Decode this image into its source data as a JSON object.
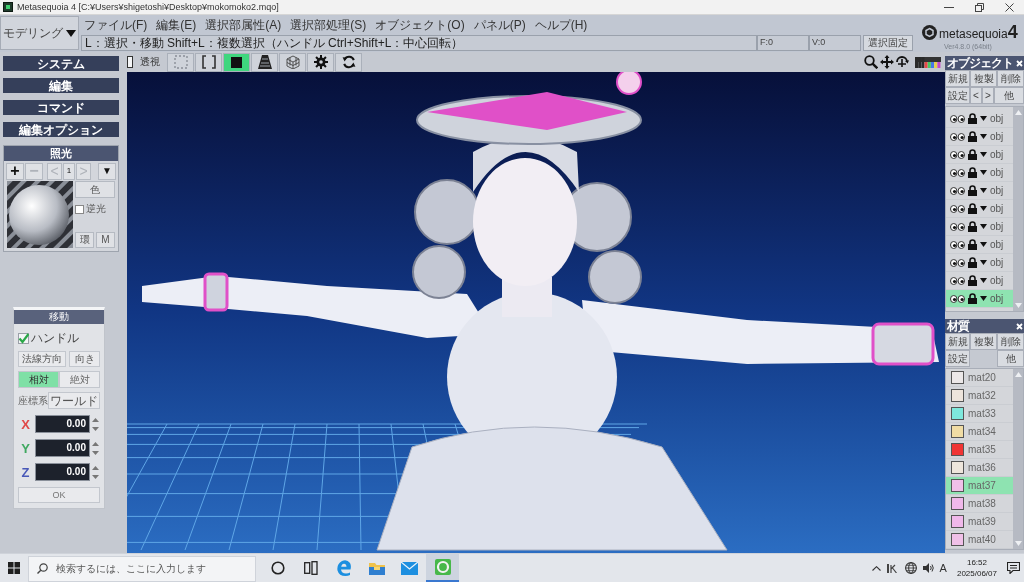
{
  "window": {
    "title": "Metasequoia 4 [C:¥Users¥shigetoshi¥Desktop¥mokomoko2.mqo]"
  },
  "mode_selector": {
    "value": "モデリング"
  },
  "menu": [
    "ファイル(F)",
    "編集(E)",
    "選択部属性(A)",
    "選択部処理(S)",
    "オブジェクト(O)",
    "パネル(P)",
    "ヘルプ(H)"
  ],
  "hint": "L：選択・移動 Shift+L：複数選択（ハンドル Ctrl+Shift+L：中心回転）",
  "counters": [
    "F:0",
    "V:0"
  ],
  "lock_selection_button": "選択固定",
  "logo": {
    "name": "metasequoia",
    "mark": "4",
    "version": "Ver4.8.0 (64bit)"
  },
  "left_panel": {
    "sections": [
      "システム",
      "編集",
      "コマンド",
      "編集オプション"
    ]
  },
  "light_panel": {
    "title": "照光",
    "controls": [
      {
        "label": "+",
        "disabled": false
      },
      {
        "label": "−",
        "disabled": true
      },
      {
        "label": "<",
        "disabled": true
      },
      {
        "label": "1",
        "disabled": false
      },
      {
        "label": ">",
        "disabled": true
      },
      {
        "label": "▼",
        "disabled": false
      }
    ],
    "color_button": "色",
    "backlight": {
      "label": "逆光",
      "checked": false
    },
    "buttons": [
      "環",
      "M"
    ]
  },
  "move_panel": {
    "title": "移動",
    "handle": {
      "label": "ハンドル",
      "checked": true
    },
    "buttons": [
      "法線方向",
      "向き"
    ],
    "modes": [
      {
        "label": "相対",
        "selected": true
      },
      {
        "label": "絶対",
        "selected": false
      }
    ],
    "coordinate_label": "座標系",
    "coordinate_button": "ワールド",
    "axes": [
      {
        "label": "X",
        "color": "#e04848",
        "value": "0.00"
      },
      {
        "label": "Y",
        "color": "#3fa860",
        "value": "0.00"
      },
      {
        "label": "Z",
        "color": "#4858b8",
        "value": "0.00"
      }
    ],
    "ok_button": "OK"
  },
  "view_toolbar": {
    "label": "透視",
    "buttons": [
      {
        "selected": false
      },
      {
        "selected": false
      },
      {
        "selected": true
      },
      {
        "selected": false
      },
      {
        "selected": false
      },
      {
        "selected": false
      },
      {
        "selected": false
      }
    ]
  },
  "objects_panel": {
    "title": "オブジェクト",
    "buttons": [
      "新規",
      "複製",
      "削除"
    ],
    "buttons_2": [
      "設定",
      "<",
      ">",
      "他"
    ],
    "items": [
      {
        "name": "obj",
        "selected": false
      },
      {
        "name": "obj",
        "selected": false
      },
      {
        "name": "obj",
        "selected": false
      },
      {
        "name": "obj",
        "selected": false
      },
      {
        "name": "obj",
        "selected": false
      },
      {
        "name": "obj",
        "selected": false
      },
      {
        "name": "obj",
        "selected": false
      },
      {
        "name": "obj",
        "selected": false
      },
      {
        "name": "obj",
        "selected": false
      },
      {
        "name": "obj",
        "selected": false
      },
      {
        "name": "obj",
        "selected": true
      }
    ]
  },
  "materials_panel": {
    "title": "材質",
    "buttons": [
      "新規",
      "複製",
      "削除"
    ],
    "buttons_2": [
      "設定",
      "他"
    ],
    "items": [
      {
        "name": "mat20",
        "color": "#ece8e8",
        "selected": false
      },
      {
        "name": "mat32",
        "color": "#ede4dc",
        "selected": false
      },
      {
        "name": "mat33",
        "color": "#7ee8dc",
        "selected": false
      },
      {
        "name": "mat34",
        "color": "#f0dca4",
        "selected": false
      },
      {
        "name": "mat35",
        "color": "#f03434",
        "selected": false
      },
      {
        "name": "mat36",
        "color": "#eee6dc",
        "selected": false
      },
      {
        "name": "mat37",
        "color": "#f0c0e8",
        "selected": true
      },
      {
        "name": "mat38",
        "color": "#f0b8ea",
        "selected": false
      },
      {
        "name": "mat39",
        "color": "#f0b8ea",
        "selected": false
      },
      {
        "name": "mat40",
        "color": "#f0c0e8",
        "selected": false
      }
    ]
  },
  "taskbar": {
    "search": {
      "placeholder": "検索するには、ここに入力します"
    },
    "apps": [
      {
        "selected": false
      },
      {
        "selected": false
      },
      {
        "selected": false
      },
      {
        "selected": false
      },
      {
        "selected": false
      },
      {
        "selected": true
      }
    ],
    "ime": "A",
    "time": "16:52",
    "date": "2025/06/07"
  }
}
